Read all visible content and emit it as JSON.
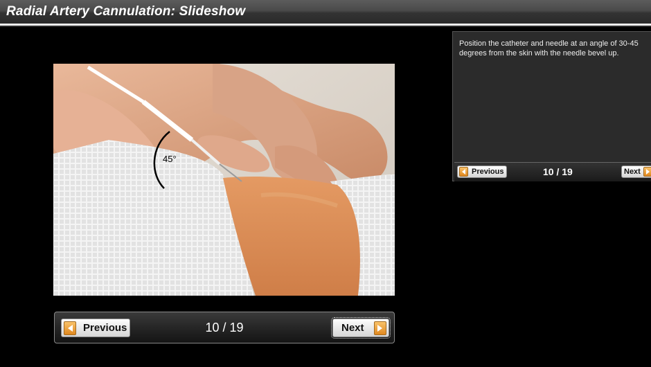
{
  "header": {
    "title": "Radial Artery Cannulation: Slideshow"
  },
  "slide": {
    "image_annotation": "45°",
    "caption": "Position the catheter and needle at an angle of 30-45 degrees from the skin with the needle bevel up."
  },
  "main_nav": {
    "previous_label": "Previous",
    "counter": "10 / 19",
    "next_label": "Next"
  },
  "side_nav": {
    "previous_label": "Previous",
    "counter": "10 / 19",
    "next_label": "Next"
  },
  "colors": {
    "accent_orange": "#e8922a",
    "background": "#000000",
    "panel": "#2b2b2b"
  }
}
